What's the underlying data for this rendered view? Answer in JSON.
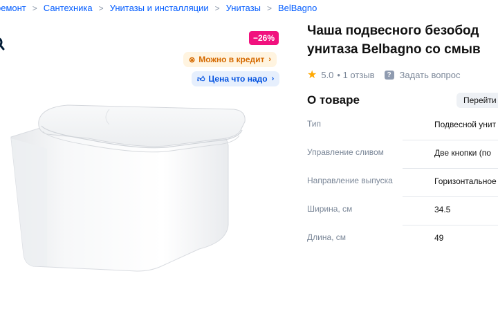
{
  "breadcrumbs": [
    "ремонт",
    "Сантехника",
    "Унитазы и инсталляции",
    "Унитазы",
    "BelBagno"
  ],
  "gallery": {
    "discount": "−26%",
    "credit_label": "Можно в кредит",
    "price_label": "Цена что надо",
    "colors": {
      "discount_bg": "#f1117e",
      "credit_bg": "#fff4e0",
      "credit_text": "#d56a00",
      "price_bg": "#e6effd",
      "price_text": "#0050e0"
    }
  },
  "product": {
    "title_line1": "Чаша подвесного безобод",
    "title_line2": "унитаза Belbagno со смыв",
    "rating": "5.0",
    "reviews": "• 1 отзыв",
    "ask_question": "Задать вопрос"
  },
  "about": {
    "heading": "О товаре",
    "goto_button": "Перейти",
    "specs": [
      {
        "key": "Тип",
        "value": "Подвесной унит"
      },
      {
        "key": "Управление сливом",
        "value": "Две кнопки (по"
      },
      {
        "key": "Направление выпуска",
        "value": "Горизонтальное"
      },
      {
        "key": "Ширина, см",
        "value": "34.5"
      },
      {
        "key": "Длина, см",
        "value": "49"
      }
    ]
  },
  "icons": {
    "search": "search-icon",
    "star": "star-icon",
    "question": "question-icon",
    "credit": "coin-icon",
    "thumb": "thumbs-up-icon",
    "chevron": "chevron-right-icon"
  }
}
